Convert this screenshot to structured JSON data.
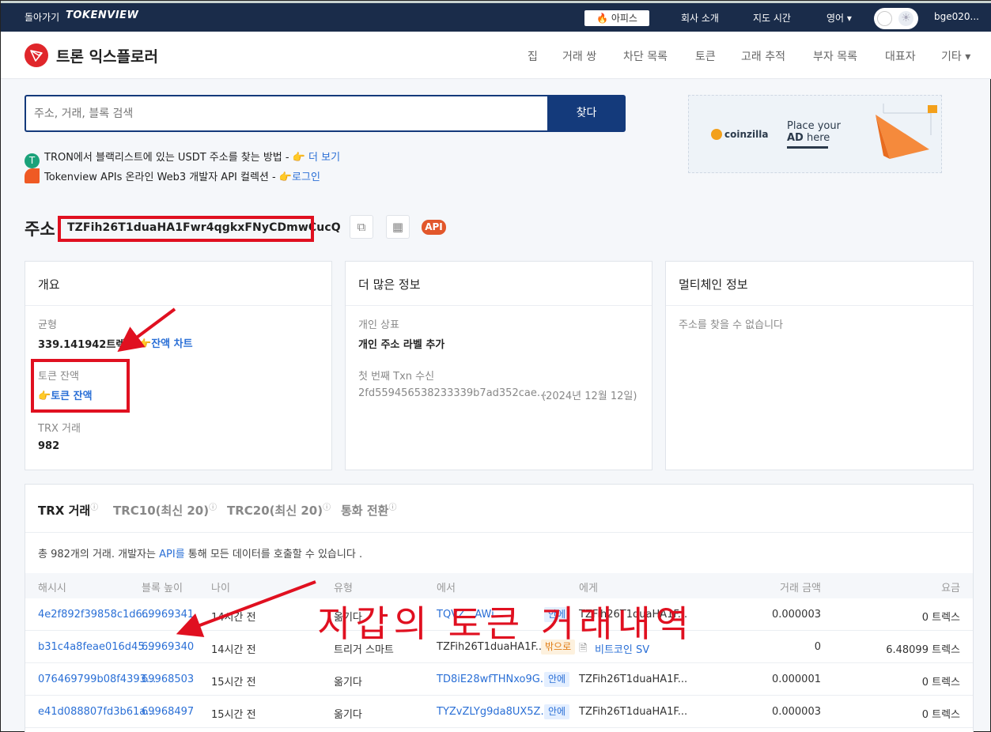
{
  "topbar": {
    "back": "돌아가기",
    "brand": "TOKENVIEW",
    "hot": "아피스",
    "links": [
      "회사 소개",
      "지도 시간",
      "영어 ▾"
    ],
    "user": "bge020..."
  },
  "header": {
    "title": "트론 익스플로러",
    "nav": [
      "집",
      "거래 쌍",
      "차단 목록",
      "토큰",
      "고래 추적",
      "부자 목록",
      "대표자",
      "기타 ▾"
    ]
  },
  "search": {
    "placeholder": "주소, 거래, 블록 검색",
    "button": "찾다"
  },
  "notices": [
    {
      "text": "TRON에서 블랙리스트에 있는 USDT 주소를 찾는 방법 - ",
      "link": "더 보기"
    },
    {
      "text": "Tokenview APIs 온라인 Web3 개발자 API 컬렉션 - ",
      "link": "로그인"
    }
  ],
  "ad": {
    "brand": "coinzilla",
    "line1": "Place your",
    "line2_bold": "AD",
    "line2": " here"
  },
  "address": {
    "label": "주소",
    "value": "TZFih26T1duaHA1Fwr4qgkxFNyCDmwCucQ",
    "api": "API"
  },
  "overview": {
    "title": "개요",
    "balance_label": "균형",
    "balance": "339.141942트렉",
    "balance_chart": "잔액 차트",
    "token_label": "토큰 잔액",
    "token_link": "토큰 잔액",
    "trx_label": "TRX 거래",
    "trx_count": "982"
  },
  "more": {
    "title": "더 많은 정보",
    "tag_label": "개인 상표",
    "tag_link": "개인 주소 라벨 추가",
    "first_label": "첫 번째 Txn 수신",
    "first_hash": "2fd559456538233339b7ad352cae...",
    "first_date": "(2024년 12월 12일)"
  },
  "multichain": {
    "title": "멀티체인 정보",
    "empty": "주소를 찾을 수 없습니다"
  },
  "tx": {
    "tabs": [
      "TRX 거래",
      "TRC10(최신 20)",
      "TRC20(최신 20)",
      "통화 전환"
    ],
    "summary_pre": "총 982개의 거래. 개발자는 ",
    "summary_api": "API를",
    "summary_post": " 통해 모든 데이터를 호출할 수 있습니다 .",
    "headers": [
      "해시시",
      "블록 높이",
      "나이",
      "유형",
      "에서",
      "에게",
      "거래 금액",
      "요금"
    ],
    "rows": [
      {
        "hash": "4e2f892f39858c1d6...",
        "block": "69969341",
        "age": "14시간 전",
        "type": "옮기다",
        "from": "TQVZ...AWi...",
        "dir": "안에",
        "to": "TZFih26T1duaHA1F...",
        "amount": "0.000003",
        "fee": "0 트렉스"
      },
      {
        "hash": "b31c4a8feae016d45...",
        "block": "69969340",
        "age": "14시간 전",
        "type": "트리거 스마트",
        "from": "TZFih26T1duaHA1F...",
        "dir": "밖으로",
        "to": "비트코인 SV",
        "amount": "0",
        "fee": "6.48099 트렉스"
      },
      {
        "hash": "076469799b08f4393...",
        "block": "69968503",
        "age": "15시간 전",
        "type": "옮기다",
        "from": "TD8iE28wfTHNxo9G...",
        "dir": "안에",
        "to": "TZFih26T1duaHA1F...",
        "amount": "0.000001",
        "fee": "0 트렉스"
      },
      {
        "hash": "e41d088807fd3b61a...",
        "block": "69968497",
        "age": "15시간 전",
        "type": "옮기다",
        "from": "TYZvZLYg9da8UX5Z...",
        "dir": "안에",
        "to": "TZFih26T1duaHA1F...",
        "amount": "0.000003",
        "fee": "0 트렉스"
      }
    ]
  },
  "annotation": "지갑의 토큰 거래내역",
  "colors": {
    "navy": "#1a2c4a",
    "brand_blue": "#143a7b",
    "link": "#2a6fd6",
    "orange": "#e07b12",
    "annot_red": "#e01020"
  }
}
